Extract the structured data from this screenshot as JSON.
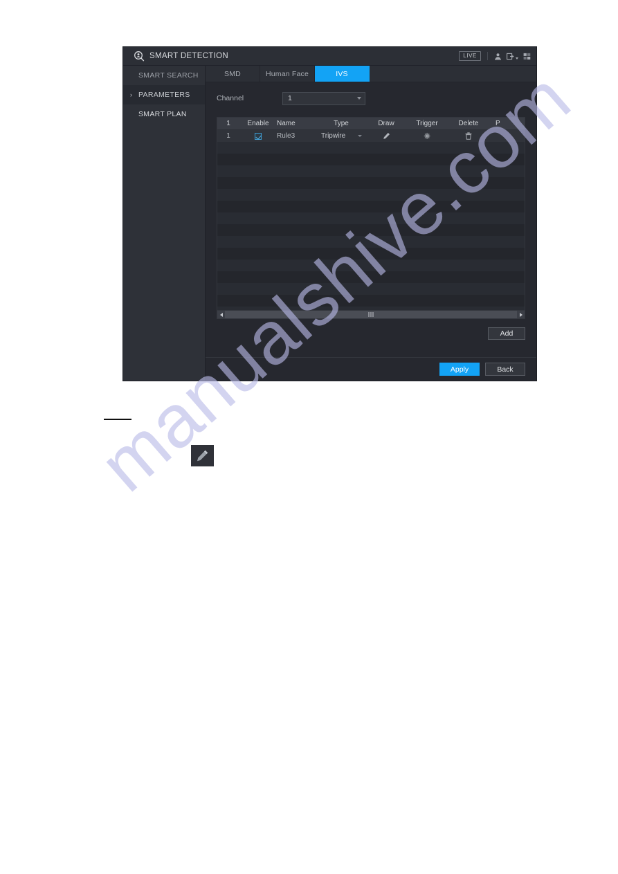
{
  "window": {
    "title": "SMART DETECTION",
    "logo_icon": "smart-detection-icon",
    "live_badge": "LIVE",
    "icons": [
      "user-icon",
      "logout-icon",
      "layout-grid-icon"
    ]
  },
  "sidebar": {
    "items": [
      {
        "label": "SMART SEARCH",
        "selected": false,
        "chevron": ""
      },
      {
        "label": "PARAMETERS",
        "selected": true,
        "chevron": "›"
      },
      {
        "label": "SMART PLAN",
        "selected": false,
        "chevron": ""
      }
    ]
  },
  "tabs": [
    {
      "label": "SMD",
      "active": false
    },
    {
      "label": "Human Face",
      "active": false
    },
    {
      "label": "IVS",
      "active": true
    }
  ],
  "form": {
    "channel_label": "Channel",
    "channel_value": "1"
  },
  "table": {
    "headers": [
      "1",
      "Enable",
      "Name",
      "Type",
      "Draw",
      "Trigger",
      "Delete",
      "P"
    ],
    "rows": [
      {
        "index": "1",
        "enable": true,
        "name": "Rule3",
        "type": "Tripwire",
        "draw_icon": "pencil-icon",
        "trigger_icon": "gear-icon",
        "delete_icon": "trash-icon"
      }
    ],
    "empty_row_count": 15
  },
  "buttons": {
    "add": "Add",
    "apply": "Apply",
    "back": "Back"
  },
  "annotations": {
    "pencil_chip_icon": "pencil-icon"
  },
  "watermark": {
    "text": "manualshive.com"
  },
  "colors": {
    "accent_blue": "#13a3f5",
    "dialog_bg": "#26282f",
    "sidebar_bg": "#2e3138",
    "table_header_bg": "#393c44",
    "watermark": "#b9bae8"
  }
}
